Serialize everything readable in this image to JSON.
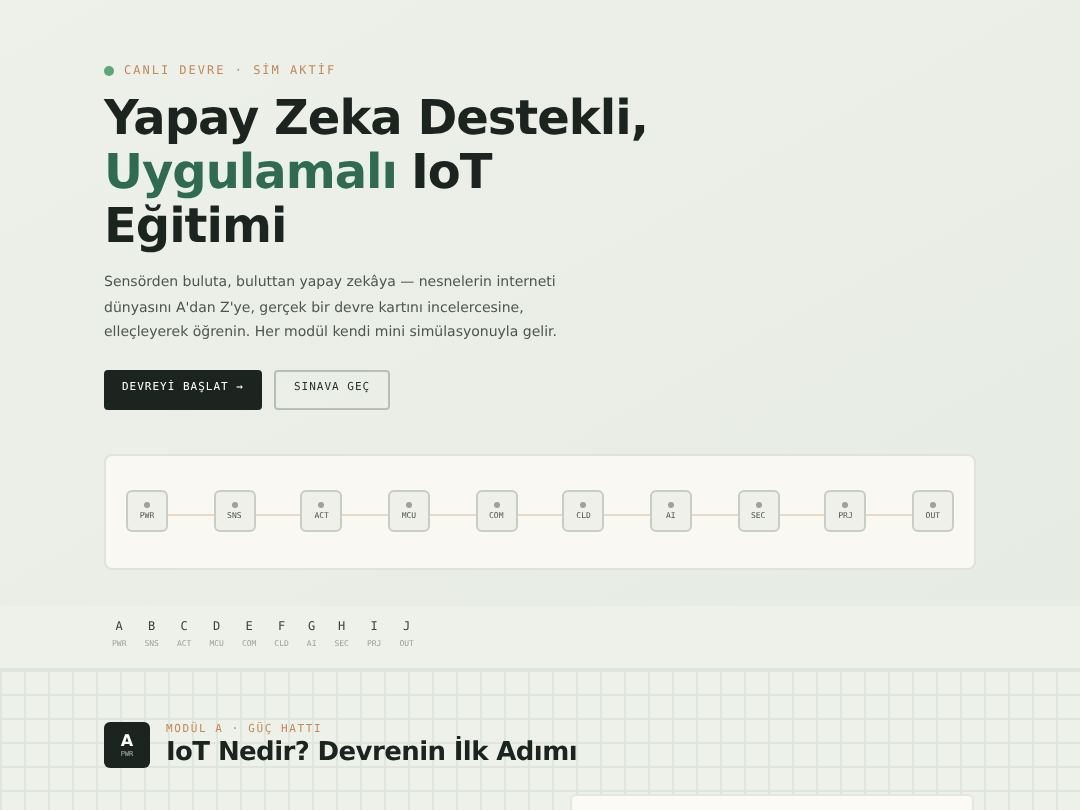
{
  "hero": {
    "status": "CANLI DEVRE · SİM AKTİF",
    "title_line1": "Yapay Zeka Destekli,",
    "title_accent": "Uygulamalı",
    "title_rest": "IoT",
    "title_line3": "Eğitimi",
    "description": "Sensörden buluta, buluttan yapay zekâya — nesnelerin interneti dünyasını A'dan Z'ye, gerçek bir devre kartını incelercesine, elleçleyerek öğrenin. Her modül kendi mini simülasyonuyla gelir.",
    "buttons": [
      {
        "label": "DEVREYİ BAŞLAT →",
        "kind": "primary"
      },
      {
        "label": "SINAVA GEÇ",
        "kind": "secondary"
      }
    ]
  },
  "circuit": {
    "nodes": [
      "PWR",
      "SNS",
      "ACT",
      "MCU",
      "COM",
      "CLD",
      "AI",
      "SEC",
      "PRJ",
      "OUT"
    ]
  },
  "module_nav": [
    {
      "letter": "A",
      "code": "PWR"
    },
    {
      "letter": "B",
      "code": "SNS"
    },
    {
      "letter": "C",
      "code": "ACT"
    },
    {
      "letter": "D",
      "code": "MCU"
    },
    {
      "letter": "E",
      "code": "COM"
    },
    {
      "letter": "F",
      "code": "CLD"
    },
    {
      "letter": "G",
      "code": "AI"
    },
    {
      "letter": "H",
      "code": "SEC"
    },
    {
      "letter": "I",
      "code": "PRJ"
    },
    {
      "letter": "J",
      "code": "OUT"
    }
  ],
  "module": {
    "letter": "A",
    "code": "PWR",
    "eyebrow": "MODÜL A · GÜÇ HATTI",
    "title": "IoT Nedir? Devrenin İlk Adımı"
  }
}
